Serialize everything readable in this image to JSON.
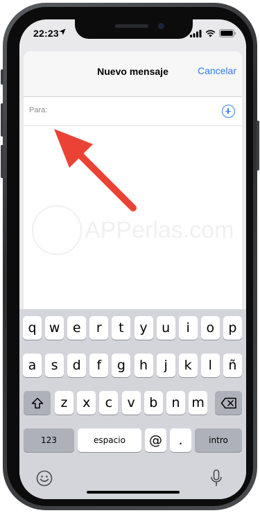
{
  "status_bar": {
    "time": "22:23"
  },
  "navbar": {
    "title": "Nuevo mensaje",
    "cancel_label": "Cancelar"
  },
  "to_field": {
    "label": "Para:"
  },
  "watermark": {
    "text": "APPerlas.com"
  },
  "keyboard": {
    "row1": [
      "q",
      "w",
      "e",
      "r",
      "t",
      "y",
      "u",
      "i",
      "o",
      "p"
    ],
    "row2": [
      "a",
      "s",
      "d",
      "f",
      "g",
      "h",
      "j",
      "k",
      "l",
      "ñ"
    ],
    "row3": [
      "z",
      "x",
      "c",
      "v",
      "b",
      "n",
      "m"
    ],
    "numbers_key": "123",
    "space_key": "espacio",
    "at_key": "@",
    "period_key": ".",
    "return_key": "intro"
  },
  "colors": {
    "accent": "#2f7cf6",
    "arrow": "#ea4335",
    "keyboard_bg": "#d3d5db"
  },
  "icons": [
    "location-arrow-icon",
    "signal-icon",
    "wifi-icon",
    "battery-icon",
    "add-contact-icon",
    "camera-icon",
    "app-store-icon",
    "send-arrow-icon",
    "shift-icon",
    "backspace-icon",
    "emoji-icon",
    "microphone-icon"
  ]
}
